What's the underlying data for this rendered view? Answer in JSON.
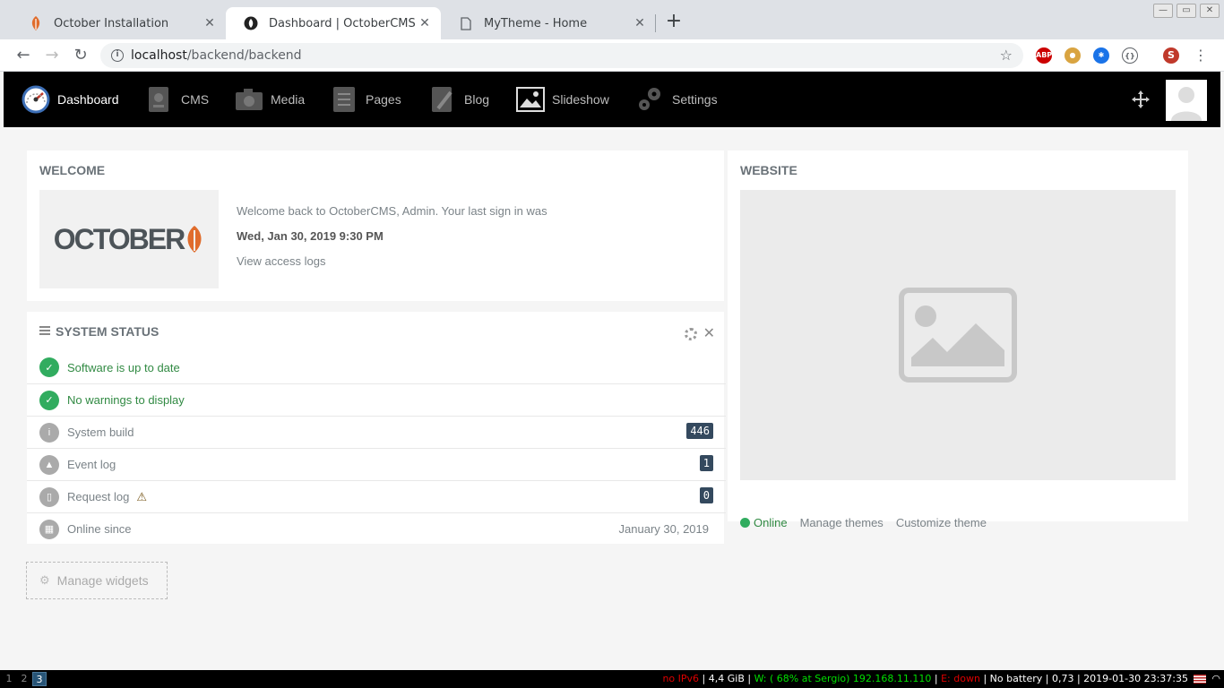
{
  "browser": {
    "tabs": [
      {
        "title": "October Installation"
      },
      {
        "title": "Dashboard | OctoberCMS"
      },
      {
        "title": "MyTheme - Home"
      }
    ],
    "url_host": "localhost",
    "url_path": "/backend/backend"
  },
  "appnav": {
    "items": [
      {
        "label": "Dashboard"
      },
      {
        "label": "CMS"
      },
      {
        "label": "Media"
      },
      {
        "label": "Pages"
      },
      {
        "label": "Blog"
      },
      {
        "label": "Slideshow"
      },
      {
        "label": "Settings"
      }
    ]
  },
  "welcome": {
    "title": "WELCOME",
    "logo_text": "OCTOBER",
    "message": "Welcome back to OctoberCMS, Admin. Your last sign in was",
    "last_signin": "Wed, Jan 30, 2019 9:30 PM",
    "access_logs_link": "View access logs"
  },
  "system_status": {
    "title": "SYSTEM STATUS",
    "rows": [
      {
        "label": "Software is up to date"
      },
      {
        "label": "No warnings to display"
      },
      {
        "label": "System build",
        "value": "446"
      },
      {
        "label": "Event log",
        "value": "1"
      },
      {
        "label": "Request log",
        "value": "0"
      },
      {
        "label": "Online since",
        "value": "January 30, 2019"
      }
    ]
  },
  "manage_widgets": "Manage widgets",
  "website": {
    "title": "WEBSITE",
    "status": "Online",
    "manage_themes": "Manage themes",
    "customize_theme": "Customize theme"
  },
  "osbar": {
    "workspaces": [
      "1",
      "2",
      "3"
    ],
    "ipv6": "no IPv6",
    "memory": "4,4 GiB",
    "wifi": "W: ( 68% at Sergio) 192.168.11.110",
    "ethernet": "E: down",
    "battery": "No battery",
    "load": "0,73",
    "datetime": "2019-01-30 23:37:35"
  },
  "colors": {
    "accent_green": "#31ac5f",
    "nav_bg": "#000000",
    "badge_bg": "#34495e",
    "october_orange": "#e06c2c"
  }
}
